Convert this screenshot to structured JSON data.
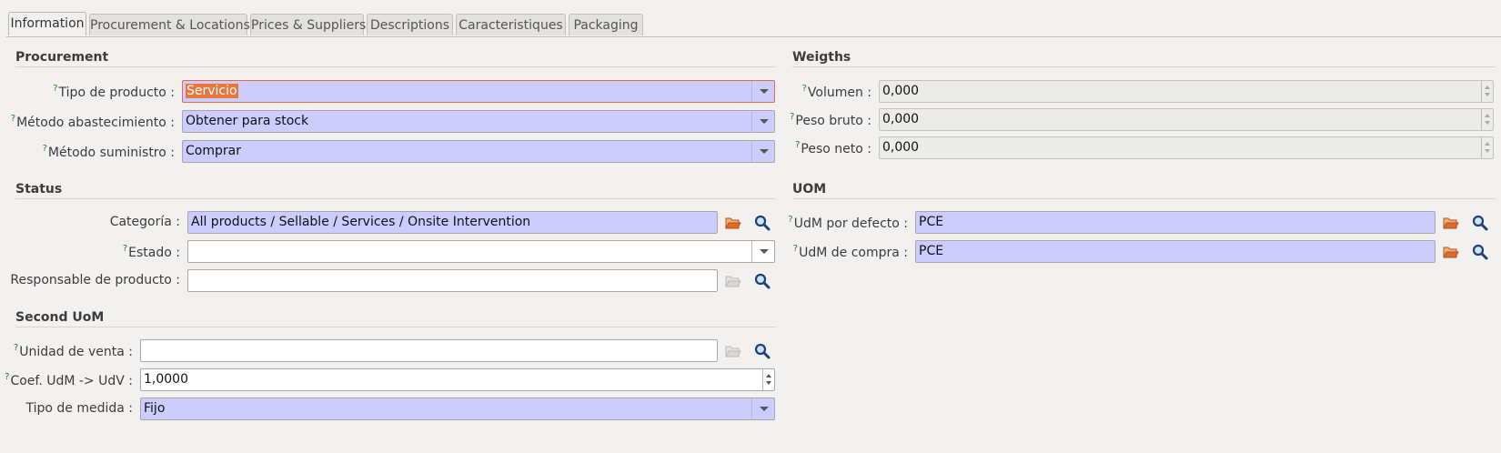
{
  "tabs": [
    {
      "label": "Information",
      "active": true
    },
    {
      "label": "Procurement & Locations"
    },
    {
      "label": "Prices & Suppliers"
    },
    {
      "label": "Descriptions"
    },
    {
      "label": "Caracteristiques"
    },
    {
      "label": "Packaging"
    }
  ],
  "procurement": {
    "title": "Procurement",
    "tipo_producto": {
      "help": "?",
      "label": "Tipo de producto :",
      "value": "Servicio"
    },
    "metodo_abastecimiento": {
      "help": "?",
      "label": "Método abastecimiento :",
      "value": "Obtener para stock"
    },
    "metodo_suministro": {
      "help": "?",
      "label": "Método suministro :",
      "value": "Comprar"
    }
  },
  "status": {
    "title": "Status",
    "categoria": {
      "label": "Categoría :",
      "value": "All products / Sellable / Services / Onsite Intervention"
    },
    "estado": {
      "help": "?",
      "label": "Estado :",
      "value": ""
    },
    "responsable": {
      "label": "Responsable de producto :",
      "value": ""
    }
  },
  "second_uom": {
    "title": "Second UoM",
    "unidad_venta": {
      "help": "?",
      "label": "Unidad de venta :",
      "value": ""
    },
    "coef": {
      "help": "?",
      "label": "Coef. UdM -> UdV :",
      "value": "1,0000"
    },
    "tipo_medida": {
      "label": "Tipo de medida :",
      "value": "Fijo"
    }
  },
  "weights": {
    "title": "Weigths",
    "volumen": {
      "help": "?",
      "label": "Volumen :",
      "value": "0,000"
    },
    "peso_bruto": {
      "help": "?",
      "label": "Peso bruto :",
      "value": "0,000"
    },
    "peso_neto": {
      "help": "?",
      "label": "Peso neto :",
      "value": "0,000"
    }
  },
  "uom": {
    "title": "UOM",
    "udm_defecto": {
      "help": "?",
      "label": "UdM por defecto :",
      "value": "PCE"
    },
    "udm_compra": {
      "help": "?",
      "label": "UdM de compra :",
      "value": "PCE"
    }
  },
  "colors": {
    "required_bg": "#ccccff",
    "help_mark": "#2b7d2b",
    "focus_border": "#e06a4a"
  },
  "icons": {
    "open": "folder-open-icon",
    "search": "search-icon"
  }
}
